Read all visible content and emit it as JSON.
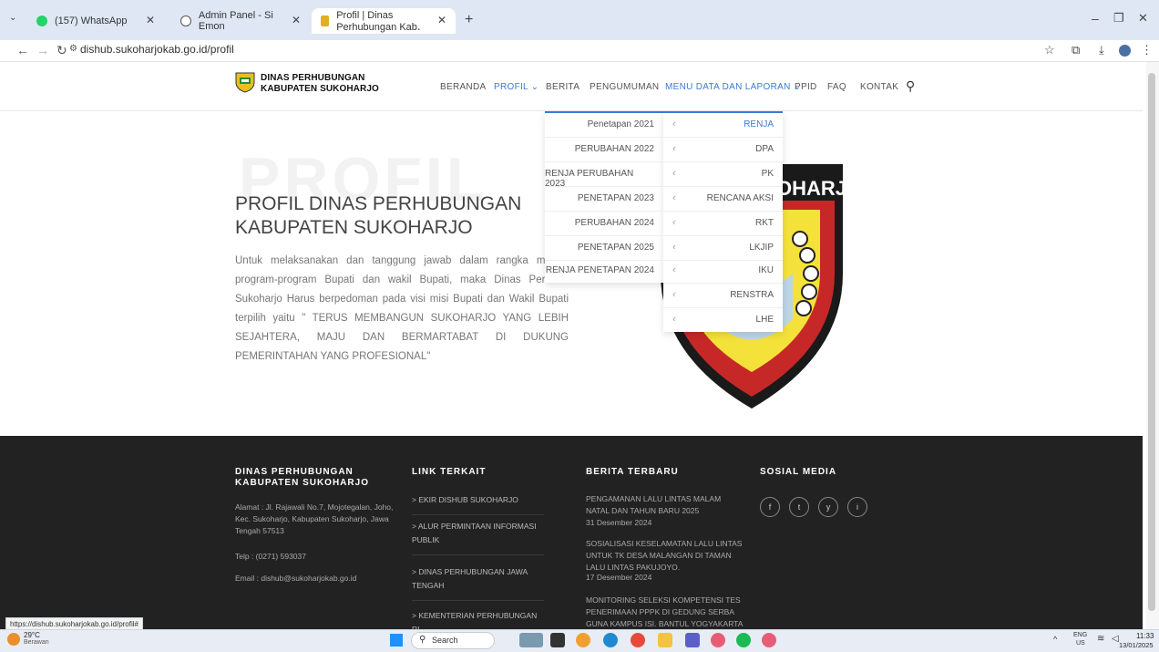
{
  "browser": {
    "tabs": [
      {
        "label": "(157) WhatsApp",
        "icon": "whatsapp-icon"
      },
      {
        "label": "Admin Panel - Si Emon",
        "icon": "globe-icon"
      },
      {
        "label": "Profil | Dinas Perhubungan Kab․",
        "icon": "site-icon"
      }
    ],
    "url": "dishub.sukoharjokab.go.id/profil",
    "status_link": "https://dishub.sukoharjokab.go.id/profil#"
  },
  "site": {
    "brand_line1": "DINAS PERHUBUNGAN",
    "brand_line2": "KABUPATEN SUKOHARJO",
    "nav": [
      "BERANDA",
      "PROFIL ⌄",
      "BERITA",
      "PENGUMUMAN",
      "MENU DATA DAN LAPORAN ⌄",
      "PPID",
      "FAQ",
      "KONTAK"
    ]
  },
  "hero": {
    "background_word": "PROFIL",
    "title_line1": "PROFIL DINAS PERHUBUNGAN",
    "title_line2": "KABUPATEN SUKOHARJO",
    "intro": "Untuk melaksanakan dan tanggung jawab dalam rangka mendu program-program Bupati dan wakil Bupati, maka Dinas Perhubu Sukoharjo Harus berpedoman pada visi misi Bupati dan Wakil Bupati terpilih yaitu \" TERUS MEMBANGUN SUKOHARJO YANG LEBIH SEJAHTERA, MAJU DAN BERMARTABAT DI DUKUNG PEMERINTAHAN YANG PROFESIONAL\""
  },
  "dropdown": {
    "left": [
      "Penetapan 2021",
      "PERUBAHAN 2022",
      "RENJA PERUBAHAN 2023",
      "PENETAPAN 2023",
      "PERUBAHAN 2024",
      "PENETAPAN 2025",
      "RENJA PENETAPAN 2024"
    ],
    "right": [
      "RENJA",
      "DPA",
      "PK",
      "RENCANA AKSI",
      "RKT",
      "LKJIP",
      "IKU",
      "RENSTRA",
      "LHE"
    ]
  },
  "emblem_text": "OHARJO",
  "footer": {
    "col1_head1": "DINAS PERHUBUNGAN",
    "col1_head2": "KABUPATEN SUKOHARJO",
    "address": "Alamat : Jl. Rajawali No.7, Mojotegalan, Joho, Kec. Sukoharjo, Kabupaten Sukoharjo, Jawa Tengah 57513",
    "phone": "Telp : (0271) 593037",
    "email": "Email : dishub@sukoharjokab.go.id",
    "col2_head": "LINK TERKAIT",
    "links": [
      "> EKIR DISHUB SUKOHARJO",
      "> ALUR PERMINTAAN INFORMASI PUBLIK",
      "> DINAS PERHUBUNGAN JAWA TENGAH",
      "> KEMENTERIAN PERHUBUNGAN RI"
    ],
    "col3_head": "BERITA TERBARU",
    "news": [
      {
        "title": "PENGAMANAN LALU LINTAS MALAM NATAL DAN TAHUN BARU 2025",
        "date": "31 Desember 2024"
      },
      {
        "title": "SOSIALISASI KESELAMATAN LALU LINTAS UNTUK TK DESA MALANGAN DI TAMAN LALU LINTAS PAKUJOYO.",
        "date": "17 Desember 2024"
      },
      {
        "title": "MONITORING SELEKSI KOMPETENSI TES PENERIMAAN PPPK DI GEDUNG SERBA GUNA KAMPUS ISI. BANTUL YOGYAKARTA",
        "date": ""
      }
    ],
    "col4_head": "SOSIAL MEDIA",
    "social": [
      "f",
      "t",
      "y",
      "i"
    ]
  },
  "taskbar": {
    "weather_temp": "29°C",
    "weather_desc": "Berawan",
    "search": "Search",
    "lang1": "ENG",
    "lang2": "US",
    "time": "11:33",
    "date": "13/01/2025"
  }
}
